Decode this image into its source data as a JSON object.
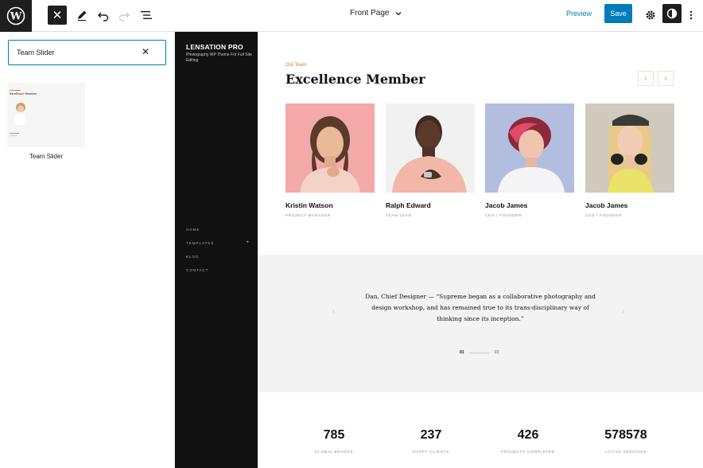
{
  "topbar": {
    "logo_icon": "wordpress-logo-icon",
    "document_title": "Front Page",
    "preview_label": "Preview",
    "save_label": "Save"
  },
  "sidebar": {
    "search_value": "Team Slider",
    "pattern_label": "Team Slider",
    "thumb_heading": "Excellence Member"
  },
  "theme": {
    "site_title": "LENSATION PRO",
    "tagline": "Photography WP Theme For Full Site Editing",
    "nav": [
      "HOME",
      "TEMPLATES",
      "BLOG",
      "CONTACT"
    ],
    "nav_plus": "+"
  },
  "team": {
    "eyebrow": "Our Team",
    "heading": "Excellence Member",
    "prev_arrow": "‹",
    "next_arrow": "›",
    "members": [
      {
        "name": "Kristin Watson",
        "role": "PROJECT MANAGER"
      },
      {
        "name": "Ralph Edward",
        "role": "TEAM LEAD"
      },
      {
        "name": "Jacob James",
        "role": "CEO / FOUNDER"
      },
      {
        "name": "Jacob James",
        "role": "CEO / FOUNDER"
      }
    ]
  },
  "testimonial": {
    "quote": "Dan, Chief Designer — “Supreme began as a collaborative photography and design workshop, and has remained true to its trans-disciplinary way of thinking since its inception.”",
    "prev": "‹",
    "next": "›",
    "page_current": "01",
    "page_total": "03"
  },
  "stats": [
    {
      "num": "785",
      "label": "GLOBAL BRANDS"
    },
    {
      "num": "237",
      "label": "HAPPY CLIENTS"
    },
    {
      "num": "426",
      "label": "PROJECTS COMPLETED"
    },
    {
      "num": "578578",
      "label": "ACTIVE SESSIONS"
    }
  ],
  "colors": {
    "accent": "#e87a1f",
    "wp_blue": "#007cba",
    "dark": "#111111"
  }
}
